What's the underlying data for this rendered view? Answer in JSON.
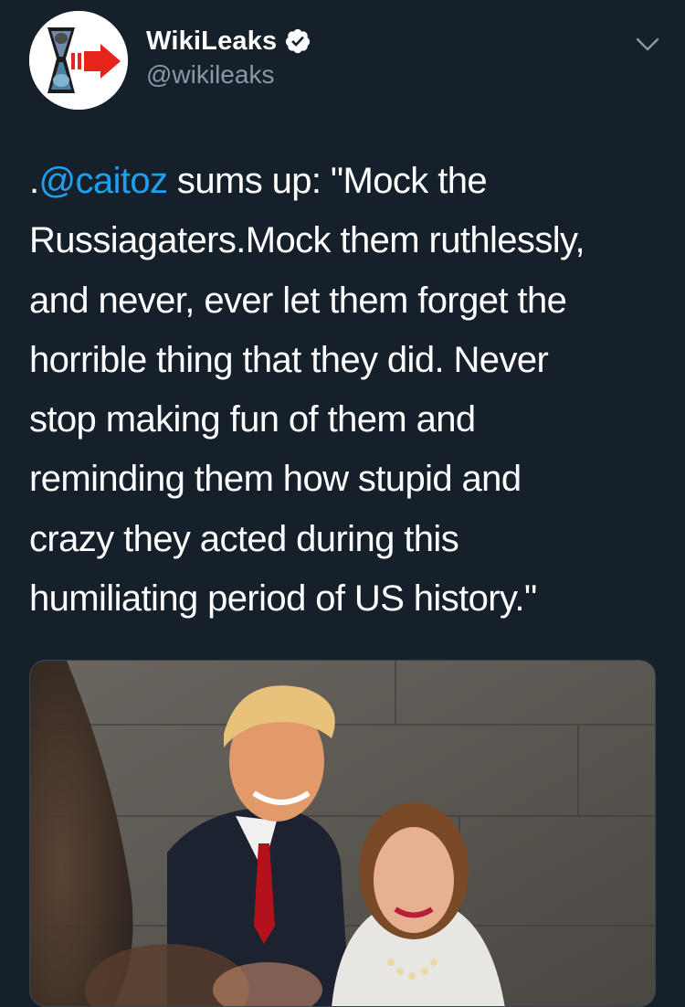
{
  "author": {
    "display_name": "WikiLeaks",
    "handle": "@wikileaks",
    "verified": true,
    "avatar_icon": "wikileaks-logo-icon"
  },
  "tweet": {
    "mention": "@caitoz",
    "lines": [
      ".",
      " sums up: \"Mock the",
      "Russiagaters.Mock them ruthlessly,",
      "and never, ever let them forget the",
      "horrible thing that they did. Never",
      "stop making fun of them and",
      "reminding them how stupid and",
      "crazy they acted during this",
      "humiliating period of US history.\""
    ]
  },
  "media": {
    "type": "photo"
  },
  "colors": {
    "background": "#15202b",
    "text": "#ffffff",
    "secondary_text": "#8899a6",
    "link": "#1da1f2",
    "verified_badge": "#ffffff"
  },
  "icons": [
    "wikileaks-logo-icon",
    "verified-badge-icon",
    "chevron-down-icon"
  ]
}
